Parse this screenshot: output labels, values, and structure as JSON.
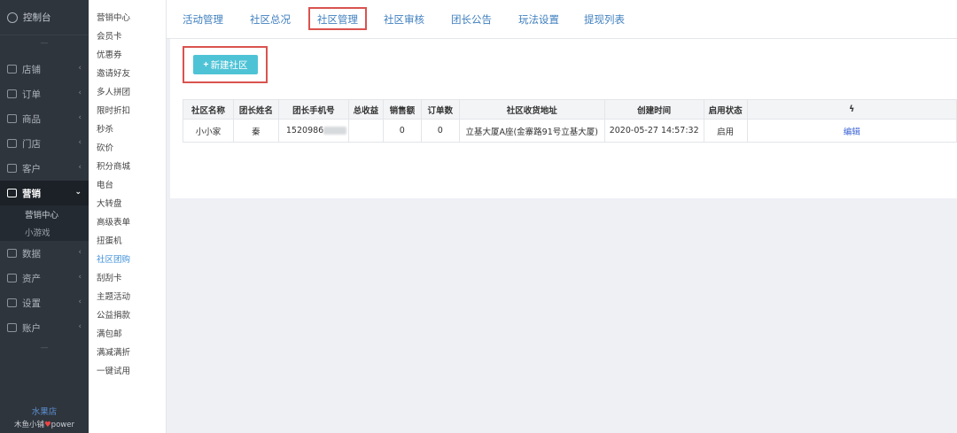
{
  "sidebar": {
    "top_label": "控制台",
    "items": [
      {
        "label": "店铺",
        "icon": "store-icon"
      },
      {
        "label": "订单",
        "icon": "order-icon"
      },
      {
        "label": "商品",
        "icon": "goods-icon"
      },
      {
        "label": "门店",
        "icon": "shop-icon"
      },
      {
        "label": "客户",
        "icon": "customer-icon"
      },
      {
        "label": "营销",
        "icon": "marketing-icon",
        "active": true
      },
      {
        "label": "数据",
        "icon": "data-icon"
      },
      {
        "label": "资产",
        "icon": "asset-icon"
      },
      {
        "label": "设置",
        "icon": "settings-icon"
      },
      {
        "label": "账户",
        "icon": "account-icon"
      }
    ],
    "sub_items": [
      "营销中心",
      "小游戏"
    ],
    "store_name": "水果店",
    "power_text_left": "木鱼小铺",
    "power_text_right": "power"
  },
  "subnav": {
    "items": [
      "营销中心",
      "会员卡",
      "优惠券",
      "邀请好友",
      "多人拼团",
      "限时折扣",
      "秒杀",
      "砍价",
      "积分商城",
      "电台",
      "大转盘",
      "高级表单",
      "扭蛋机",
      "社区团购",
      "刮刮卡",
      "主题活动",
      "公益捐款",
      "满包邮",
      "满减满折",
      "一键试用"
    ],
    "active_index": 13
  },
  "tabs": [
    "活动管理",
    "社区总况",
    "社区管理",
    "社区审核",
    "团长公告",
    "玩法设置",
    "提现列表"
  ],
  "active_tab": "社区管理",
  "new_button": {
    "label": "新建社区"
  },
  "table": {
    "headers": [
      "社区名称",
      "团长姓名",
      "团长手机号",
      "总收益",
      "销售额",
      "订单数",
      "社区收货地址",
      "创建时间",
      "启用状态",
      "ϟ"
    ],
    "rows": [
      {
        "name": "小小家",
        "leader": "秦",
        "phone": "1520986",
        "income": "",
        "sales": "0",
        "orders": "0",
        "address": "立基大厦A座(金寨路91号立基大厦)",
        "created": "2020-05-27 14:57:32",
        "status": "启用",
        "action": "编辑"
      }
    ]
  },
  "colors": {
    "accent": "#4fc3d6",
    "highlight_box": "#d9534f",
    "link": "#3f7fbf",
    "sidebar_bg": "#2f353d"
  }
}
